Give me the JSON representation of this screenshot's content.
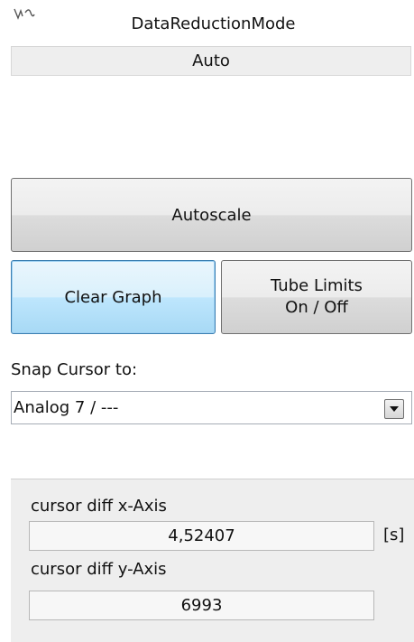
{
  "data_reduction": {
    "title": "DataReductionMode",
    "value": "Auto",
    "corner_icon": "squiggle-icon"
  },
  "buttons": {
    "autoscale": "Autoscale",
    "clear_graph": "Clear Graph",
    "tube_limits_line1": "Tube Limits",
    "tube_limits_line2": "On / Off"
  },
  "snap_cursor": {
    "label": "Snap Cursor to:",
    "selected": "Analog 7 / ---",
    "dropdown_icon": "triangle-down-icon"
  },
  "cursor_diff": {
    "x_label": "cursor diff x-Axis",
    "x_value": "4,52407",
    "x_unit": "[s]",
    "y_label": "cursor diff y-Axis",
    "y_value": "6993"
  },
  "colors": {
    "focus_border": "#3c7fb1",
    "panel_bg": "#eeeeee"
  }
}
